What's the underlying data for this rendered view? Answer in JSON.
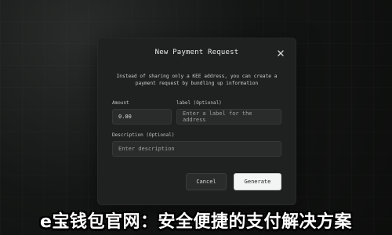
{
  "modal": {
    "title": "New Payment Request",
    "description": "Instead of sharing only a KEE address, you can create a payment request by bundling up information",
    "amount": {
      "label": "Amount",
      "value": "0.00"
    },
    "label_field": {
      "label": "label (Optional)",
      "placeholder": "Enter a label for the address"
    },
    "description_field": {
      "label": "Description (Optional)",
      "placeholder": "Enter description"
    },
    "buttons": {
      "cancel": "Cancel",
      "generate": "Generate"
    }
  },
  "caption": "e宝钱包官网：安全便捷的支付解决方案",
  "icons": {
    "close": "close-icon"
  },
  "colors": {
    "background": "#0f1110",
    "modal": "#1f2120",
    "input": "#2a2c2b",
    "primary_button": "#f3f5f4"
  }
}
